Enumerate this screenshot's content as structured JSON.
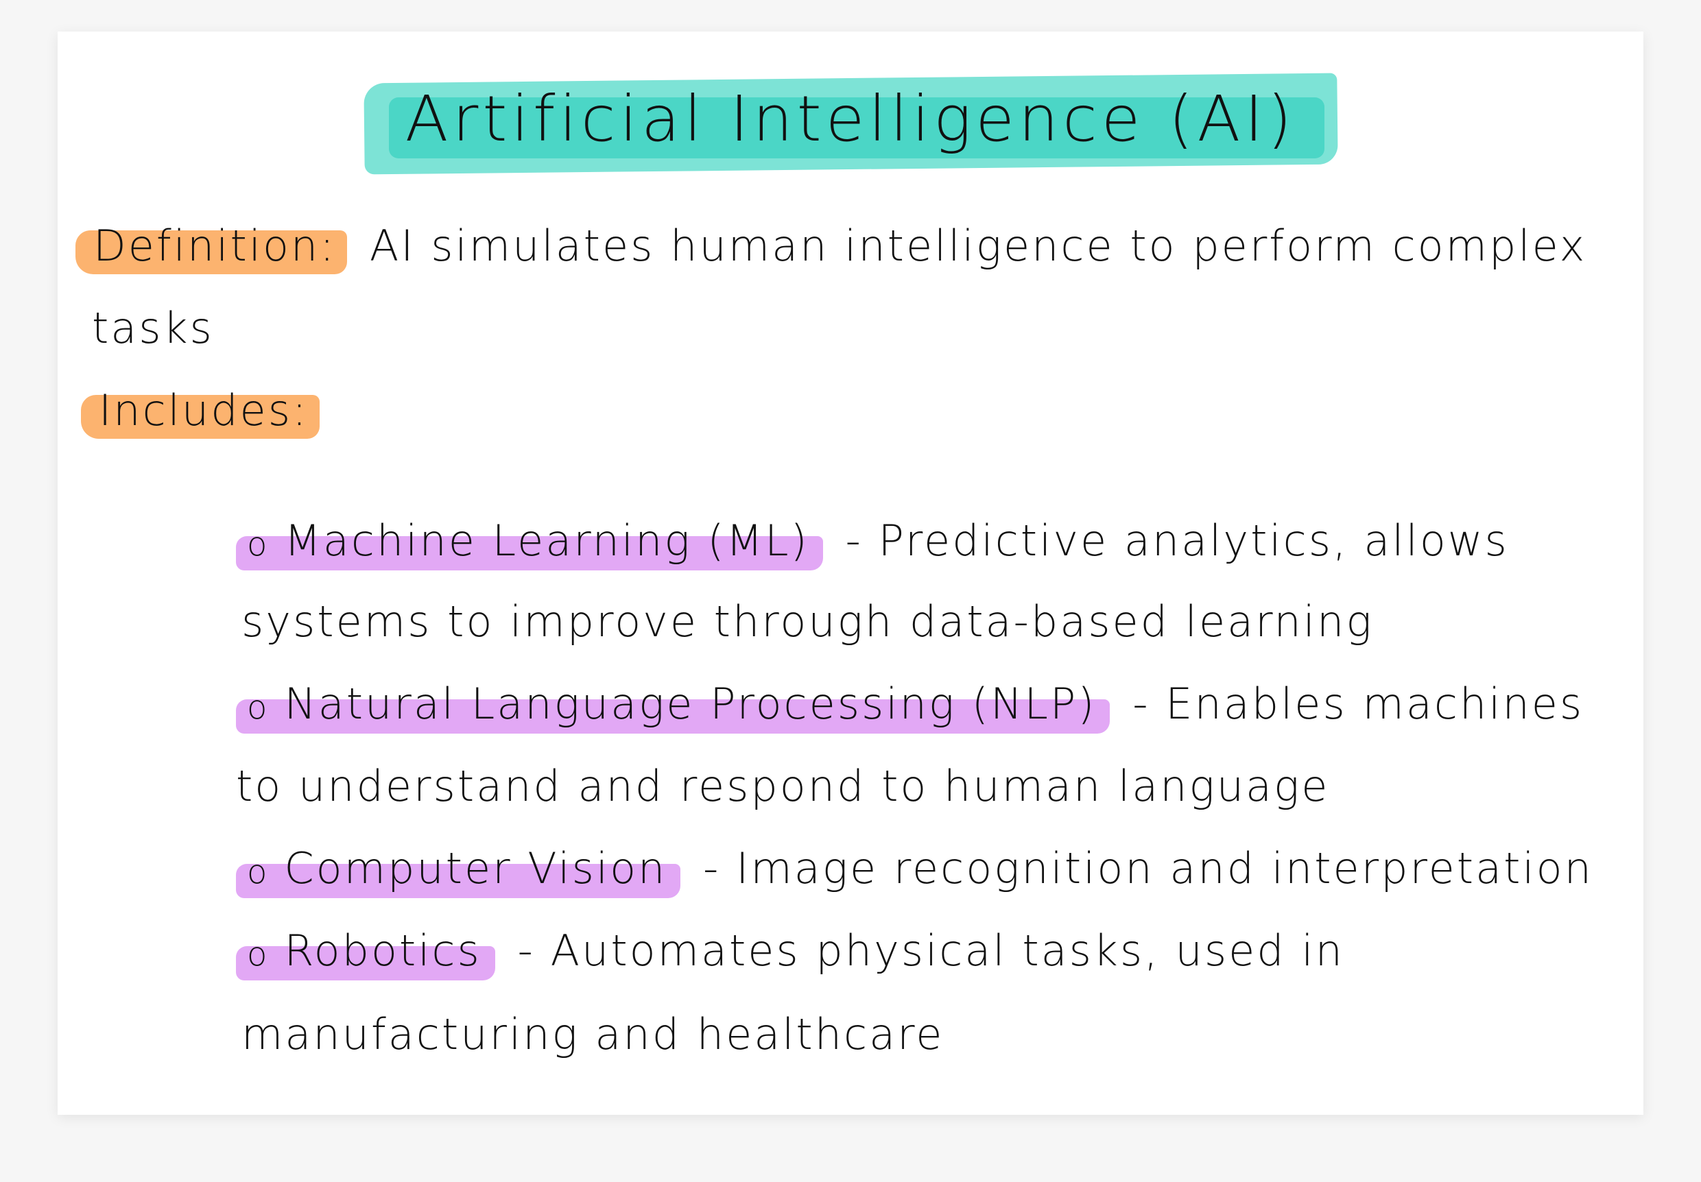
{
  "title": "Artificial Intelligence (AI)",
  "definition": {
    "label": "Definition:",
    "text_line1": "AI simulates human intelligence to perform complex",
    "text_line2": "tasks"
  },
  "includes_label": "Includes:",
  "items": [
    {
      "bullet": "o",
      "term": "Machine Learning (ML)",
      "desc_line1": "- Predictive analytics, allows",
      "desc_line2": "systems to improve through data-based learning"
    },
    {
      "bullet": "o",
      "term": "Natural Language Processing (NLP)",
      "desc_line1": "- Enables machines",
      "desc_line2": "to understand and respond to human language"
    },
    {
      "bullet": "o",
      "term": "Computer Vision",
      "desc_line1": "- Image recognition and interpretation"
    },
    {
      "bullet": "o",
      "term": "Robotics",
      "desc_line1": "- Automates physical tasks, used in",
      "desc_line2": "manufacturing and healthcare"
    }
  ],
  "colors": {
    "title_highlight": "#7de3d6",
    "label_highlight": "#fcb36f",
    "term_highlight": "#e2a8f5"
  }
}
